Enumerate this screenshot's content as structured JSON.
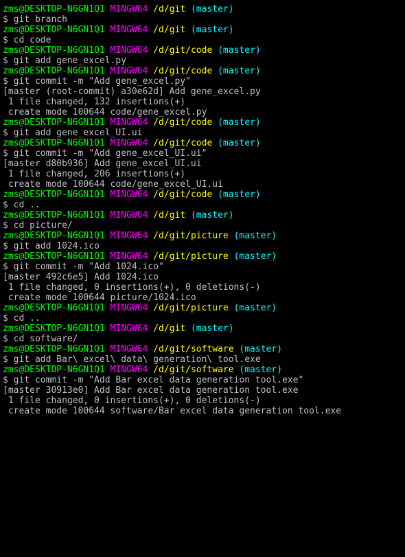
{
  "user": "zms@DESKTOP-N6GN1Q1",
  "host": "MINGW64",
  "blocks": [
    {
      "path": "/d/git",
      "branch": "(master)",
      "cmd": "git branch",
      "output": ""
    },
    {
      "path": "/d/git",
      "branch": "(master)",
      "cmd": "cd code",
      "output": ""
    },
    {
      "path": "/d/git/code",
      "branch": "(master)",
      "cmd": "git add gene_excel.py",
      "output": ""
    },
    {
      "path": "/d/git/code",
      "branch": "(master)",
      "cmd": "git commit -m \"Add gene_excel.py\"",
      "output": "[master (root-commit) a30e62d] Add gene_excel.py\n 1 file changed, 132 insertions(+)\n create mode 100644 code/gene_excel.py"
    },
    {
      "path": "/d/git/code",
      "branch": "(master)",
      "cmd": "git add gene_excel_UI.ui",
      "output": ""
    },
    {
      "path": "/d/git/code",
      "branch": "(master)",
      "cmd": "git commit -m \"Add gene_excel_UI.ui\"",
      "output": "[master d80b936] Add gene_excel_UI.ui\n 1 file changed, 206 insertions(+)\n create mode 100644 code/gene_excel_UI.ui"
    },
    {
      "path": "/d/git/code",
      "branch": "(master)",
      "cmd": "cd ..",
      "output": ""
    },
    {
      "path": "/d/git",
      "branch": "(master)",
      "cmd": "cd picture/",
      "output": ""
    },
    {
      "path": "/d/git/picture",
      "branch": "(master)",
      "cmd": "git add 1024.ico",
      "output": ""
    },
    {
      "path": "/d/git/picture",
      "branch": "(master)",
      "cmd": "git commit -m \"Add 1024.ico\"",
      "output": "[master 492c6e5] Add 1024.ico\n 1 file changed, 0 insertions(+), 0 deletions(-)\n create mode 100644 picture/1024.ico"
    },
    {
      "path": "/d/git/picture",
      "branch": "(master)",
      "cmd": "cd ..",
      "output": ""
    },
    {
      "path": "/d/git",
      "branch": "(master)",
      "cmd": "cd software/",
      "output": ""
    },
    {
      "path": "/d/git/software",
      "branch": "(master)",
      "cmd": "git add Bar\\ excel\\ data\\ generation\\ tool.exe",
      "output": ""
    },
    {
      "path": "/d/git/software",
      "branch": "(master)",
      "cmd": "git commit -m \"Add Bar excel data generation tool.exe\"",
      "output": "[master 30913e0] Add Bar excel data generation tool.exe\n 1 file changed, 0 insertions(+), 0 deletions(-)\n create mode 100644 software/Bar excel data generation tool.exe"
    }
  ]
}
